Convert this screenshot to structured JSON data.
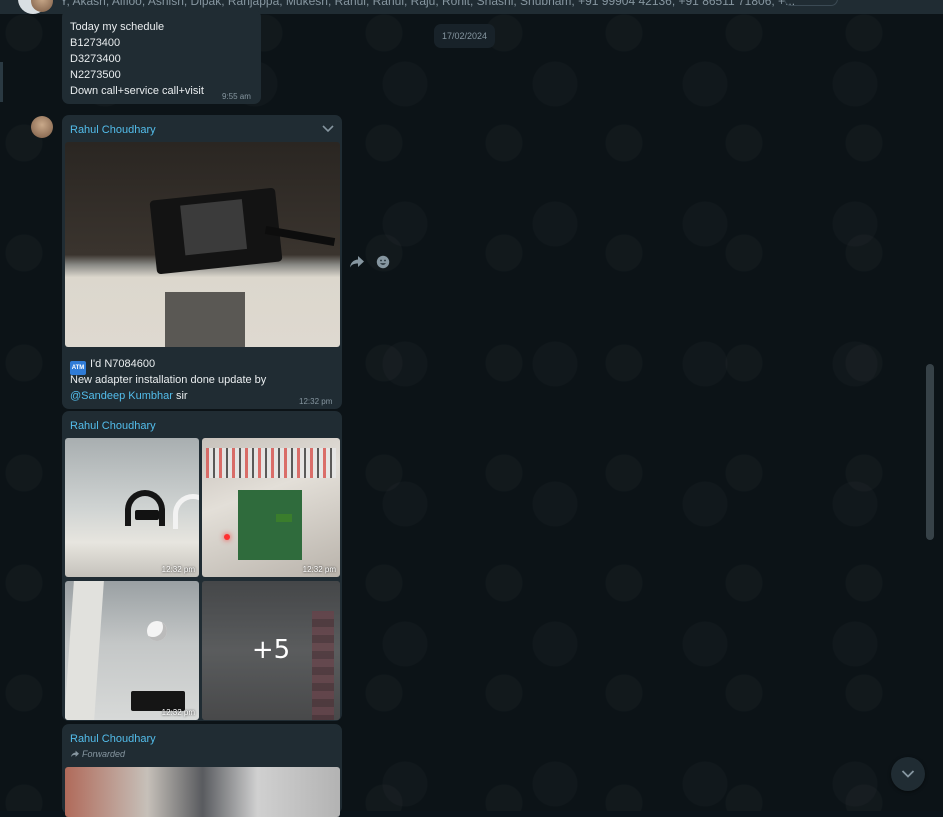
{
  "header": {
    "members_text": "Y, Akash, Alfloo, Ashish, Dipak, Ranjappa, Mukesh, Rahul, Rahul, Raju, Rohit, Shashi, Shubham, +91 99904 42136, +91 86511 71806, +..."
  },
  "chat": {
    "date_chip": "17/02/2024",
    "messages": [
      {
        "lines": [
          "Today my schedule",
          "B1273400",
          "D3273400",
          "N2273500",
          "Down call+service call+visit"
        ],
        "time": "9:55 am"
      },
      {
        "sender": "Rahul Choudhary",
        "line1": "I'd N7084600",
        "line2": "New adapter installation done update by",
        "mention": "@Sandeep Kumbhar",
        "line3_tail": " sir",
        "time": "12:32 pm",
        "atm_label": "ATM"
      },
      {
        "sender": "Rahul Choudhary",
        "image_times": [
          "12:32 pm",
          "12:32 pm",
          "12:32 pm"
        ],
        "more_count": "+5"
      },
      {
        "sender": "Rahul Choudhary",
        "forwarded_label": "Forwarded"
      }
    ]
  },
  "icons": {
    "forward": "forward-icon",
    "emoji": "emoji-icon",
    "chevron": "chevron-down-icon",
    "scroll_down": "scroll-down-icon"
  },
  "colors": {
    "background": "#0b141a",
    "bubble": "#202c33",
    "sender_name": "#53bdeb",
    "meta": "#8696a0"
  }
}
